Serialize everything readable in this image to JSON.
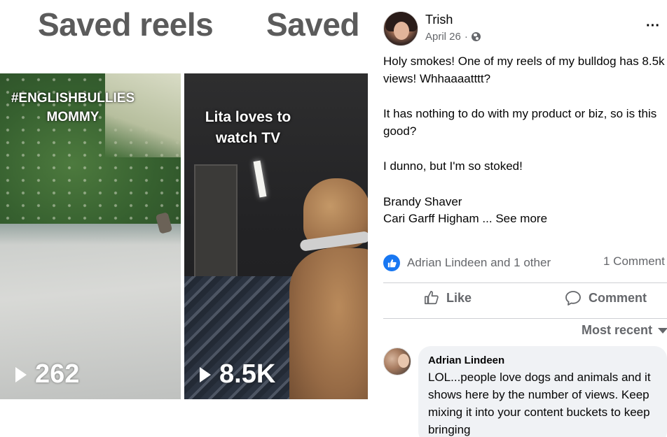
{
  "reels": {
    "tabs": [
      "Saved reels",
      "Saved"
    ],
    "items": [
      {
        "caption_line1": "#ENGLISHBULLIES",
        "caption_line2": "MOMMY",
        "views": "262"
      },
      {
        "caption_line1": "Lita loves to",
        "caption_line2": "watch TV",
        "views": "8.5K"
      }
    ]
  },
  "post": {
    "author": "Trish",
    "date": "April 26",
    "date_separator": "·",
    "more": "···",
    "paragraphs": [
      "Holy smokes! One of my reels of my bulldog has 8.5k views! Whhaaaatttt?",
      "It has nothing to do with my product or biz, so is this good?",
      "I dunno, but I'm so stoked!"
    ],
    "mention_1": "Brandy Shaver",
    "mention_2": "Cari Garff Higham",
    "see_more": "... See more",
    "reactions_text": "Adrian Lindeen and 1 other",
    "comment_count": "1 Comment",
    "like_label": "Like",
    "comment_label": "Comment",
    "sort_label": "Most recent"
  },
  "comment": {
    "author": "Adrian Lindeen",
    "text": "LOL...people love dogs and animals and it shows here by the number of views. Keep mixing it into your content buckets to keep bringing"
  },
  "colors": {
    "facebook_blue": "#1877f2",
    "secondary_text": "#65676b",
    "bubble": "#f0f2f5"
  }
}
